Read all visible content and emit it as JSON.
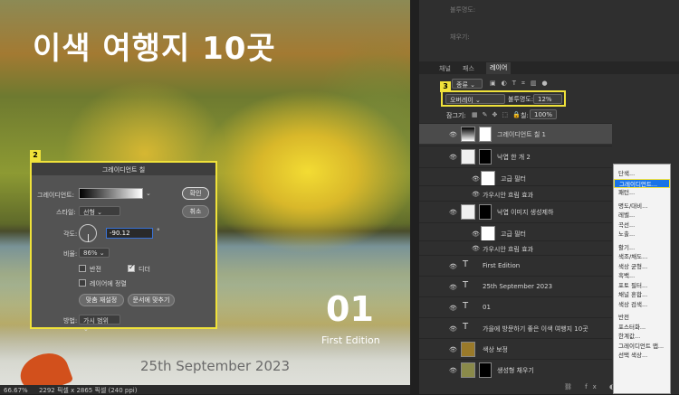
{
  "canvas": {
    "title": "이색 여행지 10곳",
    "edition_num": "01",
    "edition_label": "First Edition",
    "date": "25th September 2023"
  },
  "status": {
    "zoom": "66.67%",
    "dims": "2292 픽셀 x 2865 픽셀 (240 ppi)"
  },
  "dialog": {
    "badge": "2",
    "title": "그레이디언트 칠",
    "gradient_label": "그레이디언트:",
    "style_label": "스타일:",
    "style_value": "선형",
    "angle_label": "각도:",
    "angle_value": "-90.12",
    "angle_unit": "°",
    "scale_label": "비율:",
    "scale_value": "86%",
    "reverse": "반전",
    "dither": "디더",
    "align_layer": "레이어에 정렬",
    "reset_align": "맞춤 재설정",
    "fit_doc": "문서에 맞추기",
    "method_label": "방법:",
    "method_value": "가시 범위",
    "ok": "확인",
    "cancel": "취소"
  },
  "panel": {
    "top_labels": [
      "불투명도:",
      "채우기:"
    ],
    "tabs": [
      "채널",
      "패스",
      "레이어"
    ],
    "filter_value": "종류",
    "blend_badge": "3",
    "blend_mode": "오버레이",
    "opacity_label": "불투명도:",
    "opacity_value": "12%",
    "lock_label": "잠그기:",
    "fill_label": "칠:",
    "fill_value": "100%",
    "layers": [
      "그레이디언트 칠 1",
      "낙엽 한 개 2",
      "고급 필터",
      "가우시안 흐림 효과",
      "낙엽 이미지 생성제하",
      "고급 필터",
      "가우시안 흐림 효과",
      "First Edition",
      "25th September 2023",
      "01",
      "가을에 방문하기 좋은 이색 여행지 10곳",
      "색상 보정",
      "생성형 채우기"
    ]
  },
  "menu": {
    "badge": "1",
    "items": [
      "단색...",
      "그레이디언트...",
      "패턴...",
      "명도/대비...",
      "레벨...",
      "곡선...",
      "노출...",
      "활기...",
      "색조/채도...",
      "색상 균형...",
      "흑백...",
      "포토 필터...",
      "채널 혼합...",
      "색상 검색...",
      "반전",
      "포스터화...",
      "한계값...",
      "그레이디언트 맵...",
      "선택 색상..."
    ]
  }
}
